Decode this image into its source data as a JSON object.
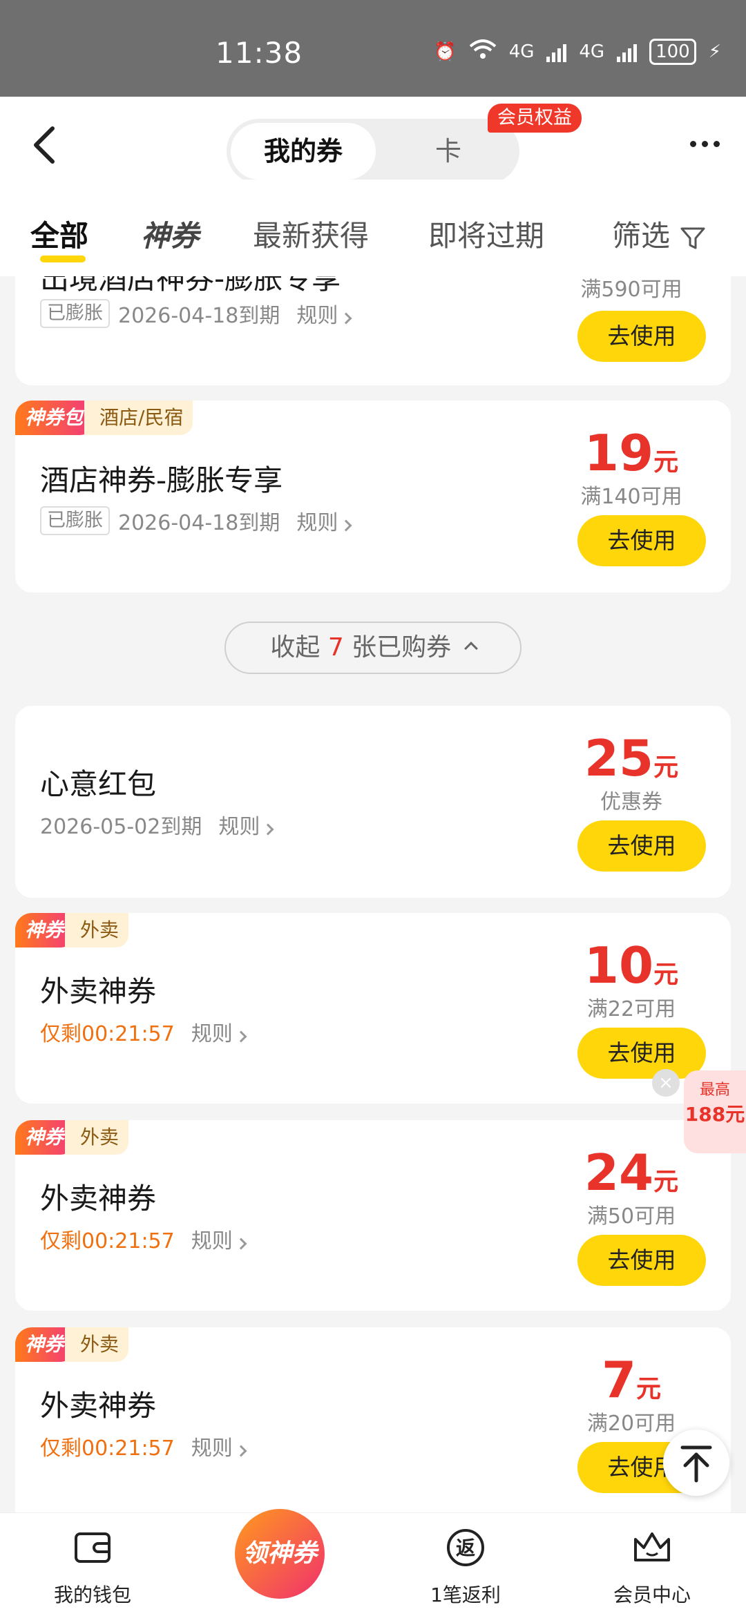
{
  "status_bar": {
    "time": "11:38",
    "network": "4G",
    "network2": "4G",
    "battery": "100"
  },
  "header": {
    "tab_active": "我的券",
    "tab_card": "卡",
    "member_badge": "会员权益"
  },
  "filters": [
    "全部",
    "神券",
    "最新获得",
    "即将过期",
    "筛选"
  ],
  "card_partial": {
    "title": "出境酒店神券-膨胀专享",
    "inflated": "已膨胀",
    "expire": "2026-04-18到期",
    "rule": "规则",
    "condition": "满590可用",
    "button": "去使用"
  },
  "card_hotel": {
    "tag1": "神券包",
    "tag2": "酒店/民宿",
    "title": "酒店神券-膨胀专享",
    "inflated": "已膨胀",
    "expire": "2026-04-18到期",
    "rule": "规则",
    "amount": "19",
    "unit": "元",
    "condition": "满140可用",
    "button": "去使用"
  },
  "collapse": {
    "prefix": "收起",
    "count": "7",
    "suffix": "张已购券"
  },
  "card_redpack": {
    "title": "心意红包",
    "expire": "2026-05-02到期",
    "rule": "规则",
    "amount": "25",
    "unit": "元",
    "condition": "优惠券",
    "button": "去使用"
  },
  "card_delivery": [
    {
      "tag1": "神券",
      "tag2": "外卖",
      "title": "外卖神券",
      "countdown": "仅剩00:21:57",
      "rule": "规则",
      "amount": "10",
      "unit": "元",
      "condition": "满22可用",
      "button": "去使用"
    },
    {
      "tag1": "神券",
      "tag2": "外卖",
      "title": "外卖神券",
      "countdown": "仅剩00:21:57",
      "rule": "规则",
      "amount": "24",
      "unit": "元",
      "condition": "满50可用",
      "button": "去使用"
    },
    {
      "tag1": "神券",
      "tag2": "外卖",
      "title": "外卖神券",
      "countdown": "仅剩00:21:57",
      "rule": "规则",
      "amount": "7",
      "unit": "元",
      "condition": "满20可用",
      "button": "去使用"
    }
  ],
  "float_ad": {
    "label": "最高",
    "value": "188元"
  },
  "bottom_nav": {
    "wallet": "我的钱包",
    "center": "领神券",
    "cashback": "1笔返利",
    "member": "会员中心",
    "cashback_icon": "返"
  },
  "colors": {
    "accent_yellow": "#ffd60a",
    "price_red": "#e8332a",
    "countdown_orange": "#f07010"
  }
}
